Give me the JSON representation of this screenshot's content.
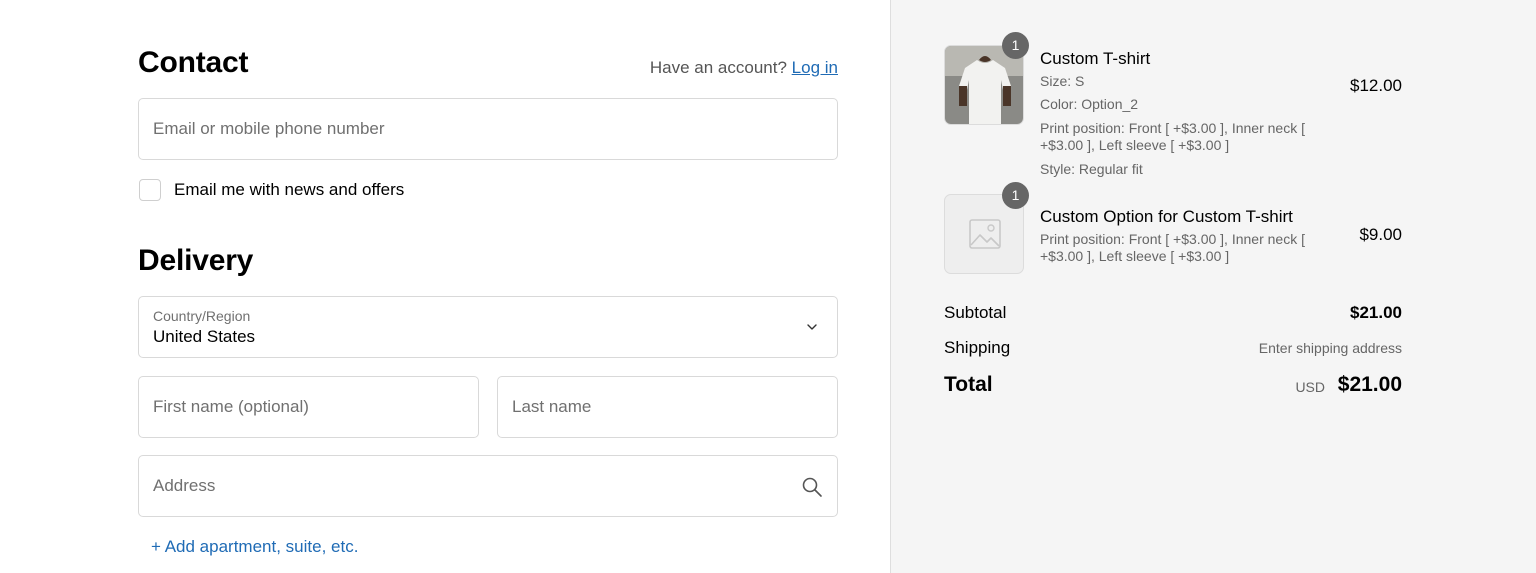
{
  "contact": {
    "title": "Contact",
    "account_prompt": "Have an account?",
    "login_label": "Log in",
    "email_placeholder": "Email or mobile phone number",
    "newsletter_label": "Email me with news and offers"
  },
  "delivery": {
    "title": "Delivery",
    "country_label": "Country/Region",
    "country_value": "United States",
    "first_name_placeholder": "First name (optional)",
    "last_name_placeholder": "Last name",
    "address_placeholder": "Address",
    "add_apartment_label": "+ Add apartment, suite, etc."
  },
  "summary": {
    "items": [
      {
        "quantity": "1",
        "name": "Custom T-shirt",
        "meta": [
          "Size: S",
          "Color: Option_2",
          "Print position: Front [ +$3.00 ], Inner neck [ +$3.00 ], Left sleeve [ +$3.00 ]",
          "Style: Regular fit"
        ],
        "price": "$12.00",
        "image_icon": "tshirt-photo"
      },
      {
        "quantity": "1",
        "name": "Custom Option for Custom T-shirt",
        "meta": [
          "Print position: Front [ +$3.00 ], Inner neck [ +$3.00 ], Left sleeve [ +$3.00 ]"
        ],
        "price": "$9.00",
        "image_icon": "image-placeholder-icon"
      }
    ],
    "subtotal_label": "Subtotal",
    "subtotal_value": "$21.00",
    "shipping_label": "Shipping",
    "shipping_value": "Enter shipping address",
    "total_label": "Total",
    "total_currency": "USD",
    "total_value": "$21.00"
  },
  "colors": {
    "link": "#1f6bb5",
    "summary_bg": "#f5f5f5",
    "badge": "#666666"
  }
}
